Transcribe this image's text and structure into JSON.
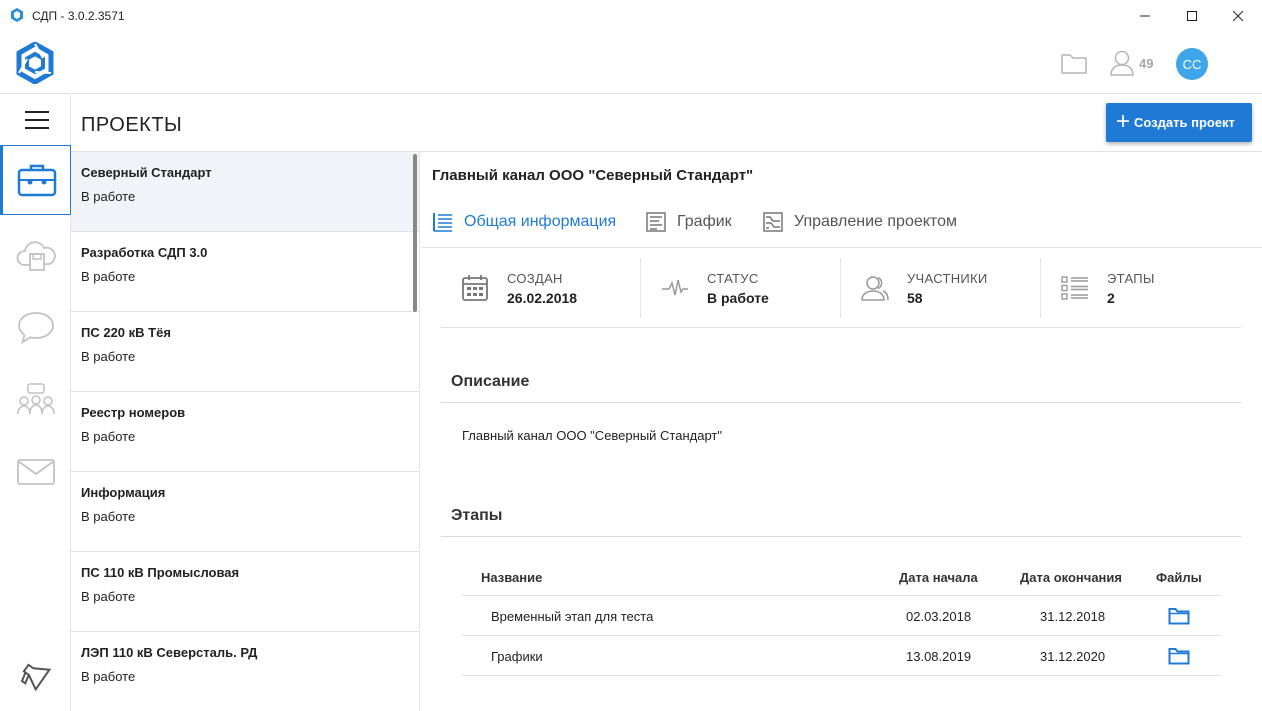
{
  "window": {
    "title": "СДП - 3.0.2.3571"
  },
  "header": {
    "user_count": "49",
    "avatar_initials": "СС"
  },
  "page": {
    "title": "ПРОЕКТЫ",
    "create_button": "Создать проект"
  },
  "projects": [
    {
      "name": "Северный Стандарт",
      "status": "В работе"
    },
    {
      "name": "Разработка СДП 3.0",
      "status": "В работе"
    },
    {
      "name": "ПС 220 кВ Тёя",
      "status": "В работе"
    },
    {
      "name": "Реестр номеров",
      "status": "В работе"
    },
    {
      "name": "Информация",
      "status": "В работе"
    },
    {
      "name": "ПС 110 кВ Промысловая",
      "status": "В работе"
    },
    {
      "name": "ЛЭП 110 кВ Северсталь. РД",
      "status": "В работе"
    }
  ],
  "detail": {
    "title": "Главный канал ООО \"Северный Стандарт\"",
    "tabs": [
      "Общая информация",
      "График",
      "Управление проектом"
    ],
    "stats": [
      {
        "label": "СОЗДАН",
        "value": "26.02.2018"
      },
      {
        "label": "СТАТУС",
        "value": "В работе"
      },
      {
        "label": "УЧАСТНИКИ",
        "value": "58"
      },
      {
        "label": "ЭТАПЫ",
        "value": "2"
      }
    ],
    "description_title": "Описание",
    "description_text": "Главный канал ООО \"Северный Стандарт\"",
    "stages_title": "Этапы",
    "stages_headers": [
      "Название",
      "Дата начала",
      "Дата окончания",
      "Файлы"
    ],
    "stages": [
      {
        "name": "Временный этап для теста",
        "start": "02.03.2018",
        "end": "31.12.2018"
      },
      {
        "name": "Графики",
        "start": "13.08.2019",
        "end": "31.12.2020"
      }
    ]
  },
  "colors": {
    "accent": "#1f7ad6",
    "avatar": "#3ea5e8",
    "selected_row": "#f2f3f8"
  }
}
